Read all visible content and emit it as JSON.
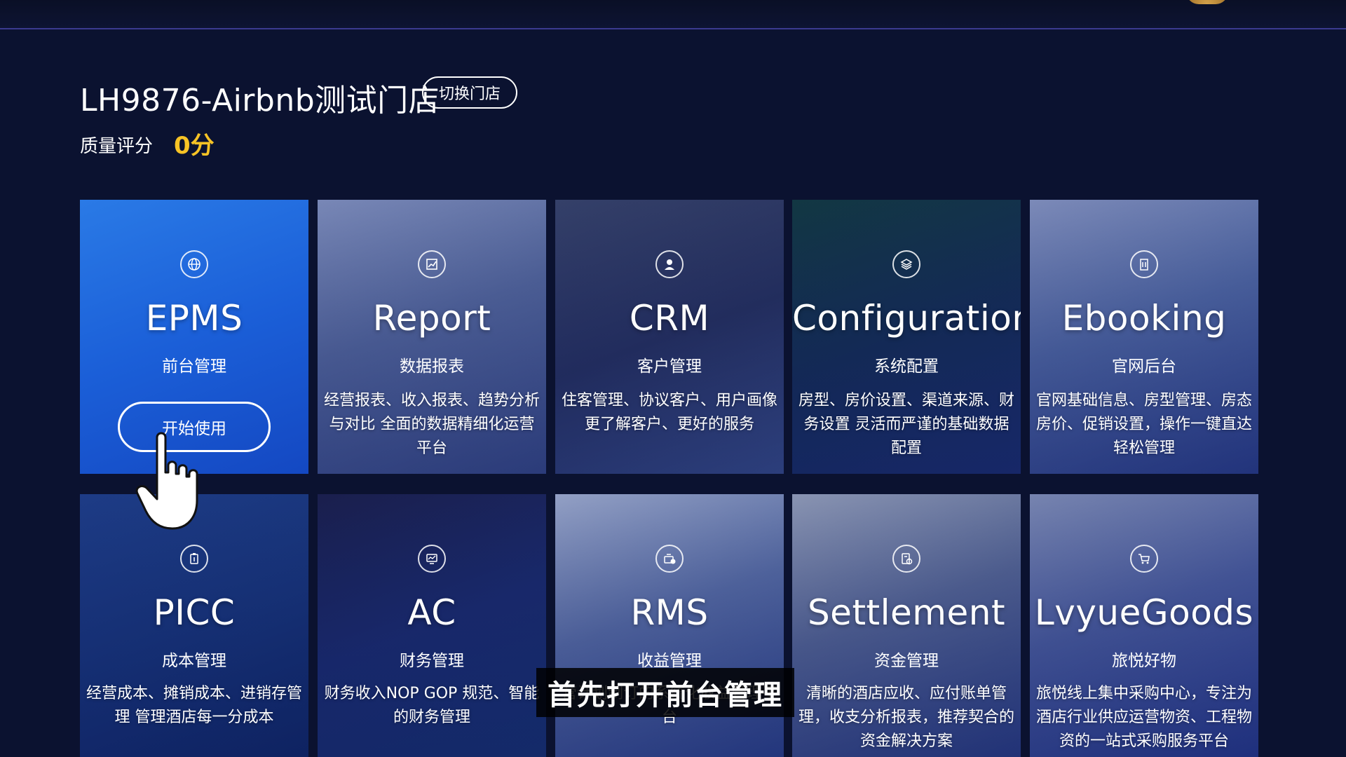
{
  "header": {
    "store_name": "LH9876-Airbnb测试门店",
    "switch_store_label": "切换门店",
    "quality_label": "质量评分",
    "quality_score": "0分"
  },
  "modules": [
    {
      "name": "EPMS",
      "subtitle": "前台管理",
      "description": "",
      "action_label": "开始使用",
      "icon": "globe-icon"
    },
    {
      "name": "Report",
      "subtitle": "数据报表",
      "description": "经营报表、收入报表、趋势分析与对比 全面的数据精细化运营平台",
      "icon": "chart-icon"
    },
    {
      "name": "CRM",
      "subtitle": "客户管理",
      "description": "住客管理、协议客户、用户画像 更了解客户、更好的服务",
      "icon": "user-icon"
    },
    {
      "name": "Configuration",
      "subtitle": "系统配置",
      "description": "房型、房价设置、渠道来源、财务设置 灵活而严谨的基础数据配置",
      "icon": "layers-icon"
    },
    {
      "name": "Ebooking",
      "subtitle": "官网后台",
      "description": "官网基础信息、房型管理、房态房价、促销设置，操作一键直达轻松管理",
      "icon": "building-icon"
    },
    {
      "name": "PICC",
      "subtitle": "成本管理",
      "description": "经营成本、摊销成本、进销存管理 管理酒店每一分成本",
      "icon": "clipboard-icon"
    },
    {
      "name": "AC",
      "subtitle": "财务管理",
      "description": "财务收入NOP GOP 规范、智能的财务管理",
      "icon": "monitor-icon"
    },
    {
      "name": "RMS",
      "subtitle": "收益管理",
      "description": "营计划制订的系统化收益管理平台",
      "icon": "revenue-icon"
    },
    {
      "name": "Settlement",
      "subtitle": "资金管理",
      "description": "清晰的酒店应收、应付账单管理，收支分析报表，推荐契合的资金解决方案",
      "icon": "settlement-icon"
    },
    {
      "name": "LvyueGoods",
      "subtitle": "旅悦好物",
      "description": "旅悦线上集中采购中心，专注为酒店行业供应运营物资、工程物资的一站式采购服务平台",
      "icon": "cart-icon"
    }
  ],
  "caption": "首先打开前台管理"
}
